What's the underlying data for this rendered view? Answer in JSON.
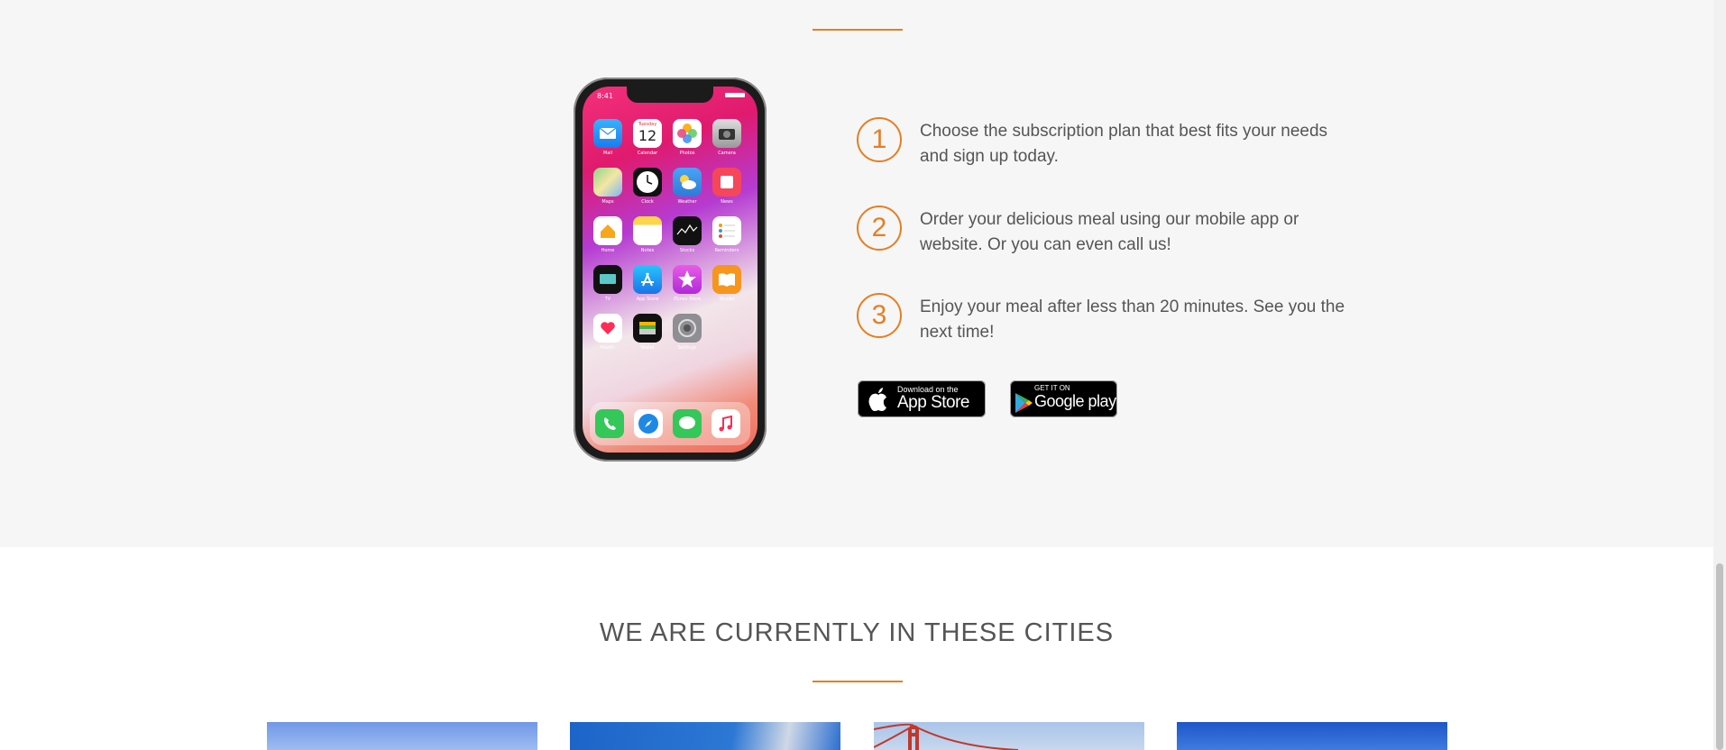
{
  "steps": [
    {
      "number": "1",
      "text": "Choose the subscription plan that best fits your needs and sign up today."
    },
    {
      "number": "2",
      "text": "Order your delicious meal using our mobile app or website. Or you can even call us!"
    },
    {
      "number": "3",
      "text": "Enjoy your meal after less than 20 minutes. See you the next time!"
    }
  ],
  "phone": {
    "time": "8:41",
    "apps": [
      "Mail",
      "Calendar",
      "Photos",
      "Camera",
      "Maps",
      "Clock",
      "Weather",
      "News",
      "Home",
      "Notes",
      "Stocks",
      "Reminders",
      "TV",
      "App Store",
      "iTunes Store",
      "iBooks",
      "Health",
      "Wallet",
      "Settings"
    ],
    "calendar_day": "Tuesday",
    "calendar_date": "12"
  },
  "badges": {
    "app_store": {
      "line1": "Download on the",
      "line2": "App Store"
    },
    "google_play": {
      "line1": "GET IT ON",
      "line2": "Google play"
    }
  },
  "cities": {
    "title": "WE ARE CURRENTLY IN THESE CITIES"
  },
  "colors": {
    "accent": "#e67e22",
    "section_bg": "#f6f6f6"
  }
}
